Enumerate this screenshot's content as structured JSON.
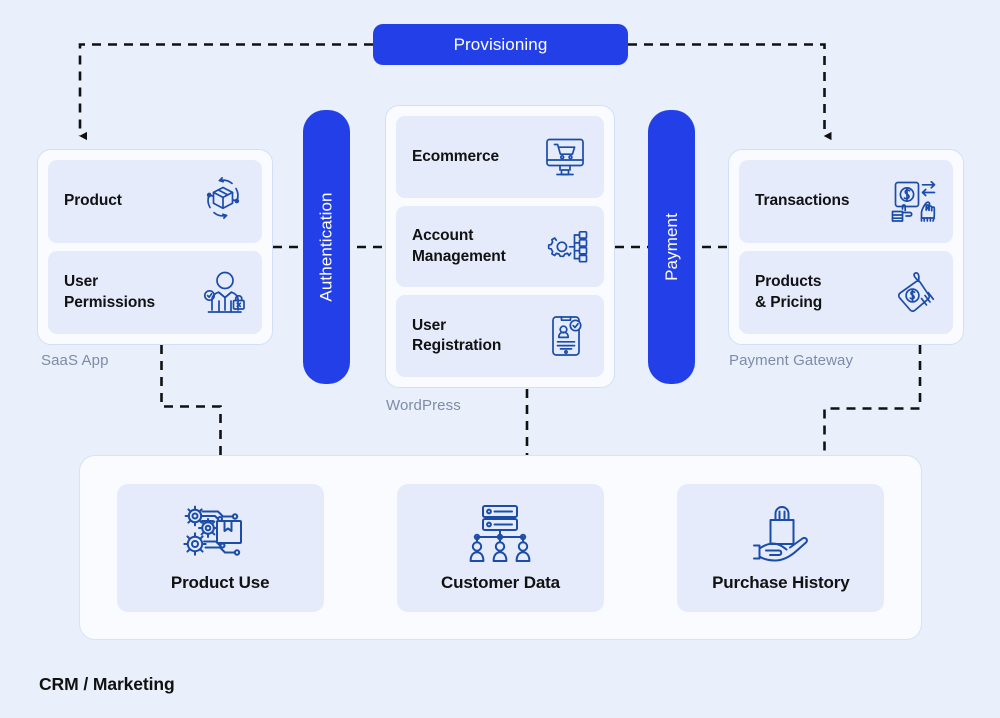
{
  "colors": {
    "background": "#E9EFFB",
    "accent_blue": "#2340E8",
    "icon_blue": "#1B4CA8",
    "card_fill": "#E5EBFB",
    "panel_fill": "#FAFBFE",
    "panel_border": "#D2E0F7",
    "caption_gray": "#7D8CA8",
    "connector_black": "#111111",
    "label_black": "#121212"
  },
  "top_bar": {
    "label": "Provisioning"
  },
  "vertical_bars": [
    {
      "id": "authentication",
      "label": "Authentication"
    },
    {
      "id": "payment",
      "label": "Payment"
    }
  ],
  "groups": [
    {
      "id": "saas-app",
      "caption": "SaaS App",
      "items": [
        {
          "label": "Product",
          "icon": "product-rotation-icon"
        },
        {
          "label": "User\nPermissions",
          "line1": "User",
          "line2": "Permissions",
          "icon": "user-permissions-icon"
        }
      ]
    },
    {
      "id": "wordpress",
      "caption": "WordPress",
      "items": [
        {
          "label": "Ecommerce",
          "line1": "Ecommerce",
          "line2": "",
          "icon": "ecommerce-monitor-cart-icon"
        },
        {
          "label": "Account Management",
          "line1": "Account",
          "line2": "Management",
          "icon": "account-management-gear-icon"
        },
        {
          "label": "User Registration",
          "line1": "User",
          "line2": "Registration",
          "icon": "user-registration-form-icon"
        }
      ]
    },
    {
      "id": "payment-gateway",
      "caption": "Payment Gateway",
      "items": [
        {
          "label": "Transactions",
          "line1": "Transactions",
          "line2": "",
          "icon": "transactions-hand-money-icon"
        },
        {
          "label": "Products & Pricing",
          "line1": "Products",
          "line2": "& Pricing",
          "icon": "price-tags-icon"
        }
      ]
    }
  ],
  "crm": {
    "title": "CRM / Marketing",
    "cards": [
      {
        "label": "Product Use",
        "icon": "product-use-gears-icon"
      },
      {
        "label": "Customer Data",
        "icon": "customer-data-org-icon"
      },
      {
        "label": "Purchase History",
        "icon": "purchase-history-bag-hand-icon"
      }
    ]
  },
  "connectors": [
    {
      "id": "provisioning-to-saas",
      "style": "dashed",
      "arrow": true
    },
    {
      "id": "provisioning-to-payment-gateway",
      "style": "dashed",
      "arrow": true
    },
    {
      "id": "saas-to-authentication",
      "style": "dashed",
      "arrow": false
    },
    {
      "id": "authentication-to-wordpress",
      "style": "dashed",
      "arrow": false
    },
    {
      "id": "wordpress-to-payment",
      "style": "dashed",
      "arrow": false
    },
    {
      "id": "payment-to-payment-gateway",
      "style": "dashed",
      "arrow": false
    },
    {
      "id": "saas-to-crm-product-use",
      "style": "dashed",
      "arrow": true
    },
    {
      "id": "wordpress-to-crm-customer-data",
      "style": "dashed",
      "arrow": true
    },
    {
      "id": "payment-gateway-to-crm-purchase-history",
      "style": "dashed",
      "arrow": true
    }
  ]
}
